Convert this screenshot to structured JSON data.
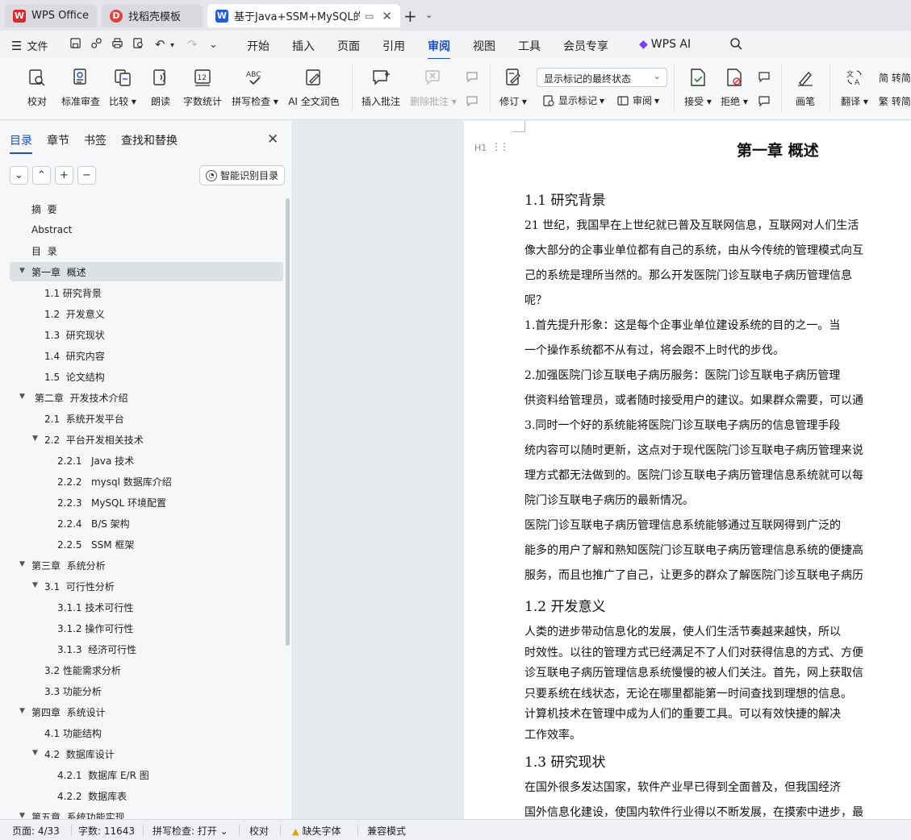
{
  "tabs": [
    {
      "label": "WPS Office",
      "logo": "W",
      "color": "#e0252b"
    },
    {
      "label": "找稻壳模板",
      "logo": "D",
      "color": "#e5413a"
    },
    {
      "label": "基于Java+SSM+MySQL的电",
      "logo": "W",
      "color": "#1f5de8"
    }
  ],
  "menubar": {
    "file_label": "文件",
    "items": [
      "开始",
      "插入",
      "页面",
      "引用",
      "审阅",
      "视图",
      "工具",
      "会员专享"
    ],
    "active": "审阅",
    "wps_ai": "WPS AI"
  },
  "ribbon": {
    "proofread": "校对",
    "standard_review": "标准审查",
    "compare": "比较",
    "read_aloud": "朗读",
    "word_count": "字数统计",
    "spell_check": "拼写检查",
    "ai_polish": "AI 全文润色",
    "insert_comment": "插入批注",
    "delete_comment": "删除批注",
    "track_changes": "修订",
    "markup_display": "显示标记的最终状态",
    "show_markup": "显示标记",
    "review_pane": "审阅",
    "accept": "接受",
    "reject": "拒绝",
    "ink": "画笔",
    "translate": "翻译",
    "simp_trad_1": "简 转简",
    "simp_trad_2": "繁 转简"
  },
  "nav": {
    "tabs": [
      "目录",
      "章节",
      "书签",
      "查找和替换"
    ],
    "smart_toc": "智能识别目录",
    "toc": [
      {
        "text": "摘  要",
        "level": 1,
        "arrow": ""
      },
      {
        "text": "Abstract",
        "level": 1,
        "arrow": ""
      },
      {
        "text": "目  录",
        "level": 1,
        "arrow": ""
      },
      {
        "text": "第一章  概述",
        "level": 1,
        "arrow": "▼",
        "selected": true
      },
      {
        "text": "1.1 研究背景",
        "level": 2,
        "arrow": ""
      },
      {
        "text": "1.2  开发意义",
        "level": 2,
        "arrow": ""
      },
      {
        "text": "1.3  研究现状",
        "level": 2,
        "arrow": ""
      },
      {
        "text": "1.4  研究内容",
        "level": 2,
        "arrow": ""
      },
      {
        "text": "1.5  论文结构",
        "level": 2,
        "arrow": ""
      },
      {
        "text": " 第二章  开发技术介绍",
        "level": 1,
        "arrow": "▼"
      },
      {
        "text": "2.1  系统开发平台",
        "level": 2,
        "arrow": ""
      },
      {
        "text": "2.2  平台开发相关技术",
        "level": 2,
        "arrow": "▼"
      },
      {
        "text": "2.2.1   Java 技术",
        "level": 3,
        "arrow": ""
      },
      {
        "text": "2.2.2   mysql 数据库介绍",
        "level": 3,
        "arrow": ""
      },
      {
        "text": "2.2.3   MySQL 环境配置",
        "level": 3,
        "arrow": ""
      },
      {
        "text": "2.2.4   B/S 架构",
        "level": 3,
        "arrow": ""
      },
      {
        "text": "2.2.5   SSM 框架",
        "level": 3,
        "arrow": ""
      },
      {
        "text": "第三章  系统分析",
        "level": 1,
        "arrow": "▼"
      },
      {
        "text": "3.1  可行性分析",
        "level": 2,
        "arrow": "▼"
      },
      {
        "text": "3.1.1 技术可行性",
        "level": 3,
        "arrow": ""
      },
      {
        "text": "3.1.2 操作可行性",
        "level": 3,
        "arrow": ""
      },
      {
        "text": "3.1.3  经济可行性",
        "level": 3,
        "arrow": ""
      },
      {
        "text": "3.2 性能需求分析",
        "level": 2,
        "arrow": ""
      },
      {
        "text": "3.3 功能分析",
        "level": 2,
        "arrow": ""
      },
      {
        "text": "第四章  系统设计",
        "level": 1,
        "arrow": "▼"
      },
      {
        "text": "4.1 功能结构",
        "level": 2,
        "arrow": ""
      },
      {
        "text": "4.2  数据库设计",
        "level": 2,
        "arrow": "▼"
      },
      {
        "text": "4.2.1  数据库 E/R 图",
        "level": 3,
        "arrow": ""
      },
      {
        "text": "4.2.2  数据库表",
        "level": 3,
        "arrow": ""
      },
      {
        "text": "第五章  系统功能实现",
        "level": 1,
        "arrow": "▼"
      }
    ]
  },
  "document": {
    "chapter_title": "第一章  概述",
    "h1_tag": "H1",
    "lines": [
      {
        "t": "1.1 研究背景",
        "k": "sec"
      },
      {
        "t": "      21 世纪，我国早在上世纪就已普及互联网信息，互联网对人们生活",
        "k": "para"
      },
      {
        "t": "像大部分的企事业单位都有自己的系统，由从今传统的管理模式向互",
        "k": "para"
      },
      {
        "t": "己的系统是理所当然的。那么开发医院门诊互联电子病历管理信息",
        "k": "para"
      },
      {
        "t": "呢？",
        "k": "para"
      },
      {
        "t": "      1.首先提升形象：这是每个企事业单位建设系统的目的之一。当",
        "k": "para"
      },
      {
        "t": "一个操作系统都不从有过，将会跟不上时代的步伐。",
        "k": "para"
      },
      {
        "t": "      2.加强医院门诊互联电子病历服务：医院门诊互联电子病历管理",
        "k": "para"
      },
      {
        "t": "供资料给管理员，或者随时接受用户的建议。如果群众需要，可以通",
        "k": "para"
      },
      {
        "t": "      3.同时一个好的系统能将医院门诊互联电子病历的信息管理手段",
        "k": "para"
      },
      {
        "t": "统内容可以随时更新，这点对于现代医院门诊互联电子病历管理来说",
        "k": "para"
      },
      {
        "t": "理方式都无法做到的。医院门诊互联电子病历管理信息系统就可以每",
        "k": "para"
      },
      {
        "t": "院门诊互联电子病历的最新情况。",
        "k": "para"
      },
      {
        "t": "      医院门诊互联电子病历管理信息系统能够通过互联网得到广泛的",
        "k": "para"
      },
      {
        "t": "能多的用户了解和熟知医院门诊互联电子病历管理信息系统的便捷高",
        "k": "para"
      },
      {
        "t": "服务，而且也推广了自己，让更多的群众了解医院门诊互联电子病历",
        "k": "para"
      },
      {
        "t": "1.2  开发意义",
        "k": "sec"
      },
      {
        "t": "      人类的进步带动信息化的发展，使人们生活节奏越来越快，所以",
        "k": "para"
      },
      {
        "t": "时效性。以往的管理方式已经满足不了人们对获得信息的方式、方便",
        "k": "para"
      },
      {
        "t": "诊互联电子病历管理信息系统慢慢的被人们关注。首先，网上获取信",
        "k": "para"
      },
      {
        "t": "只要系统在线状态，无论在哪里都能第一时间查找到理想的信息。",
        "k": "para"
      },
      {
        "t": "      计算机技术在管理中成为人们的重要工具。可以有效快捷的解决",
        "k": "para"
      },
      {
        "t": "工作效率。",
        "k": "para"
      },
      {
        "t": "1.3  研究现状",
        "k": "sec"
      },
      {
        "t": "      在国外很多发达国家，软件产业早已得到全面普及，但我国经济",
        "k": "para"
      },
      {
        "t": "国外信息化建设，使国内软件行业得以不断发展，在摸索中进步，最",
        "k": "para"
      }
    ]
  },
  "status": {
    "page": "页面: 4/33",
    "words": "字数: 11643",
    "spell": "拼写检查: 打开",
    "proof": "校对",
    "missing_font": "缺失字体",
    "compat": "兼容模式"
  }
}
